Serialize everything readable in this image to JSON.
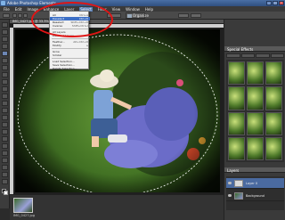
{
  "window": {
    "title": "Adobe Photoshop Elements"
  },
  "menubar": {
    "items": [
      "File",
      "Edit",
      "Image",
      "Enhance",
      "Layer",
      "Select",
      "Filter",
      "View",
      "Window",
      "Help"
    ],
    "active_index": 5
  },
  "optionsbar": {
    "organize_label": "Organize"
  },
  "document": {
    "tab_label": "IMG_0427.jpg @ 33.3% (Layer 0, RGB/8)"
  },
  "select_menu": {
    "items": [
      {
        "label": "All",
        "shortcut": "Ctrl+A"
      },
      {
        "label": "Deselect",
        "shortcut": "Ctrl+D"
      },
      {
        "label": "Reselect",
        "shortcut": "Shift+Ctrl+D"
      },
      {
        "label": "Inverse",
        "shortcut": "Shift+Ctrl+I"
      },
      {
        "label": "All Layers",
        "shortcut": ""
      },
      {
        "label": "Deselect Layers",
        "shortcut": ""
      },
      {
        "label": "Feather...",
        "shortcut": "Alt+Ctrl+D"
      },
      {
        "label": "Modify",
        "shortcut": "▸"
      },
      {
        "label": "Grow",
        "shortcut": ""
      },
      {
        "label": "Similar",
        "shortcut": ""
      },
      {
        "label": "Load Selection...",
        "shortcut": ""
      },
      {
        "label": "Save Selection...",
        "shortcut": ""
      },
      {
        "label": "Delete Selection...",
        "shortcut": ""
      }
    ],
    "highlighted_index": 1
  },
  "panels": {
    "effects_title": "Special Effects",
    "layers_title": "Layers",
    "layers": [
      {
        "name": "Layer 0"
      },
      {
        "name": "Background"
      }
    ]
  },
  "projectbin": {
    "caption": "IMG_0427.jpg"
  },
  "colors": {
    "annotation": "#e01515",
    "menu_highlight": "#3c6fc6"
  }
}
